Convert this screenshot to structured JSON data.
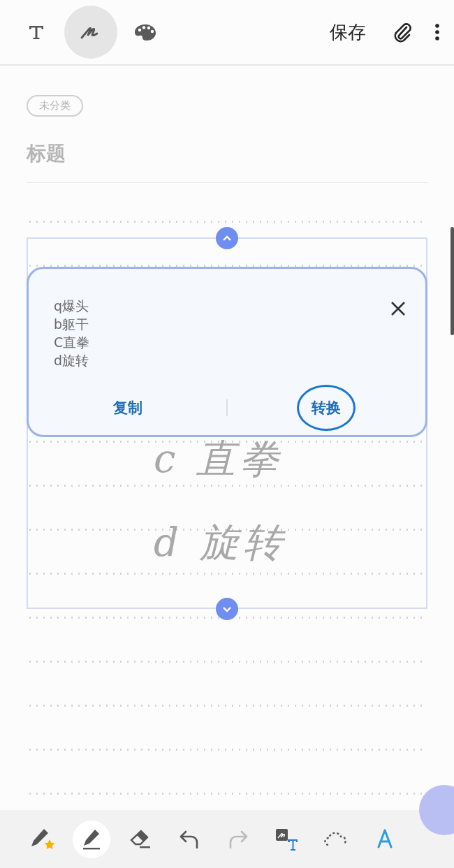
{
  "header": {
    "modes": [
      {
        "kind": "text",
        "selected": false
      },
      {
        "kind": "pen",
        "selected": true
      },
      {
        "kind": "palette",
        "selected": false
      }
    ],
    "save": "保存"
  },
  "category": "未分类",
  "title_placeholder": "标题",
  "handwriting": [
    "c 直拳",
    "d 旋转"
  ],
  "popup": {
    "recognized": [
      "q爆头",
      "b躯干",
      "C直拳",
      "d旋转"
    ],
    "actions": [
      {
        "label": "复制",
        "circled": false
      },
      {
        "label": "转换",
        "circled": true
      }
    ]
  },
  "tools": [
    {
      "kind": "favorite-pen",
      "selected": false,
      "disabled": false
    },
    {
      "kind": "pen",
      "selected": true,
      "disabled": false
    },
    {
      "kind": "eraser",
      "selected": false,
      "disabled": false
    },
    {
      "kind": "undo",
      "selected": false,
      "disabled": false
    },
    {
      "kind": "redo",
      "selected": false,
      "disabled": true
    },
    {
      "kind": "convert",
      "selected": false,
      "disabled": false
    },
    {
      "kind": "lasso",
      "selected": false,
      "disabled": false
    },
    {
      "kind": "pen-a",
      "selected": false,
      "disabled": false
    }
  ]
}
